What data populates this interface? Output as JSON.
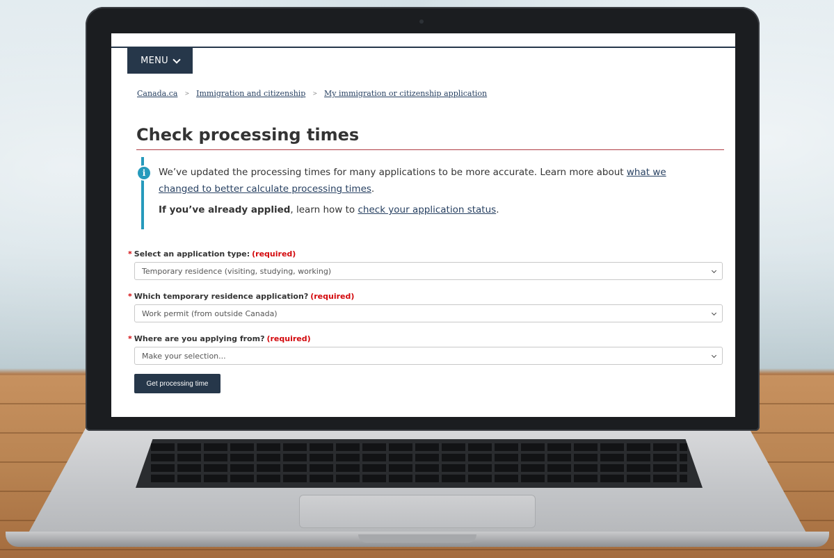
{
  "header": {
    "menu_label": "MENU"
  },
  "breadcrumb": {
    "items": [
      "Canada.ca",
      "Immigration and citizenship",
      "My immigration or citizenship application"
    ],
    "separator": ">"
  },
  "page": {
    "title": "Check processing times"
  },
  "alert": {
    "icon": "info-icon",
    "line1_prefix": "We’ve updated the processing times for many applications to be more accurate. Learn more about ",
    "line1_link": "what we changed to better calculate processing times",
    "line1_suffix": ".",
    "line2_bold": "If you’ve already applied",
    "line2_middle": ", learn how to ",
    "line2_link": "check your application status",
    "line2_suffix": "."
  },
  "form": {
    "required_marker": "*",
    "required_text": "(required)",
    "fields": [
      {
        "label": "Select an application type:",
        "value": "Temporary residence (visiting, studying, working)"
      },
      {
        "label": "Which temporary residence application?",
        "value": "Work permit (from outside Canada)"
      },
      {
        "label": "Where are you applying from?",
        "value": "Make your selection..."
      }
    ],
    "submit_label": "Get processing time"
  },
  "colors": {
    "brand_dark": "#26374a",
    "link": "#284162",
    "required_red": "#d3080c",
    "title_rule": "#af3c43",
    "info_blue": "#269abc"
  }
}
